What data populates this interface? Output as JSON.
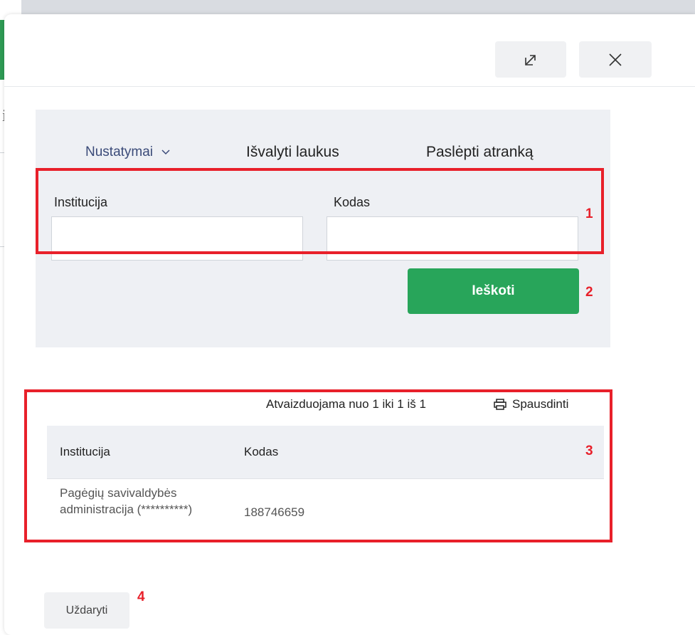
{
  "header": {
    "expand_icon": "expand-icon",
    "close_icon": "close-icon"
  },
  "filter": {
    "settings_label": "Nustatymai",
    "clear_label": "Išvalyti laukus",
    "hide_label": "Paslėpti atranką",
    "institution_label": "Institucija",
    "code_label": "Kodas",
    "institution_value": "",
    "code_value": "",
    "search_label": "Ieškoti"
  },
  "results": {
    "summary": "Atvaizduojama nuo 1 iki 1 iš 1",
    "print_label": "Spausdinti",
    "columns": [
      "Institucija",
      "Kodas"
    ],
    "rows": [
      {
        "institution": "Pagėgių savivaldybės administracija (**********)",
        "code": "188746659"
      }
    ]
  },
  "footer": {
    "close_label": "Uždaryti"
  },
  "annotations": [
    "1",
    "2",
    "3",
    "4"
  ],
  "colors": {
    "accent_green": "#28a55a",
    "annotation_red": "#e8202a",
    "panel_bg": "#eef0f4"
  }
}
